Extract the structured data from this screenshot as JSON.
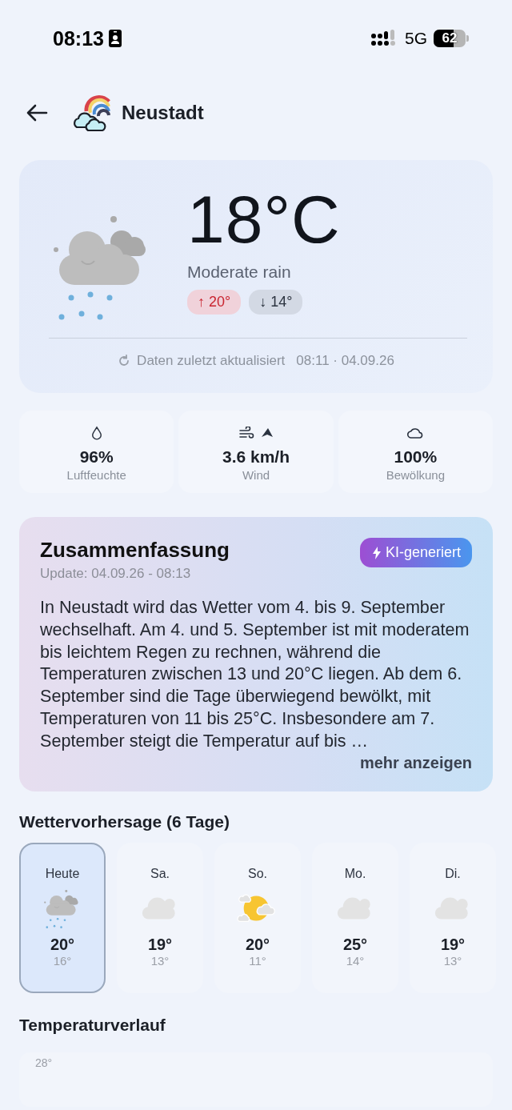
{
  "status_bar": {
    "time": "08:13",
    "network": "5G",
    "battery": "62"
  },
  "header": {
    "city": "Neustadt"
  },
  "current": {
    "temperature": "18°C",
    "condition": "Moderate rain",
    "high": "↑ 20°",
    "low": "↓ 14°",
    "updated_label": "Daten zuletzt aktualisiert",
    "updated_time": "08:11 · 04.09.26"
  },
  "stats": [
    {
      "kind": "humidity",
      "value": "96%",
      "label": "Luftfeuchte"
    },
    {
      "kind": "wind",
      "value": "3.6 km/h",
      "label": "Wind"
    },
    {
      "kind": "clouds",
      "value": "100%",
      "label": "Bewölkung"
    }
  ],
  "summary": {
    "title": "Zusammenfassung",
    "badge": "KI-generiert",
    "update": "Update: 04.09.26 - 08:13",
    "text": "In Neustadt wird das Wetter vom 4. bis 9. September wechselhaft. Am 4. und 5. September ist mit moderatem bis leichtem Regen zu rechnen, während die Temperaturen zwischen 13 und 20°C liegen. Ab dem 6. September sind die Tage überwiegend bewölkt, mit Temperaturen von 11 bis 25°C. Insbesondere am 7. September steigt die Temperatur auf bis …",
    "more": "mehr anzeigen"
  },
  "forecast": {
    "title": "Wettervorhersage (6 Tage)",
    "days": [
      {
        "day": "Heute",
        "kind": "rain",
        "high": "20°",
        "low": "16°",
        "selected": true
      },
      {
        "day": "Sa.",
        "kind": "cloudy",
        "high": "19°",
        "low": "13°",
        "selected": false
      },
      {
        "day": "So.",
        "kind": "partly_sunny",
        "high": "20°",
        "low": "11°",
        "selected": false
      },
      {
        "day": "Mo.",
        "kind": "cloudy",
        "high": "25°",
        "low": "14°",
        "selected": false
      },
      {
        "day": "Di.",
        "kind": "cloudy",
        "high": "19°",
        "low": "13°",
        "selected": false
      }
    ]
  },
  "temperature_chart": {
    "title": "Temperaturverlauf",
    "y_label": "28°"
  }
}
